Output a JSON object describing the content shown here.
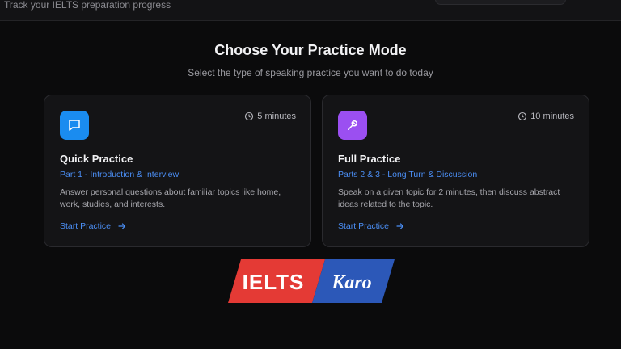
{
  "header": {
    "subtitle": "Track your IELTS preparation progress"
  },
  "hero": {
    "title": "Choose Your Practice Mode",
    "subtitle": "Select the type of speaking practice you want to do today"
  },
  "cards": [
    {
      "icon": "chat-bubble-icon",
      "accent": "#1a8cf0",
      "duration": "5 minutes",
      "title": "Quick Practice",
      "part": "Part 1 - Introduction & Interview",
      "description": "Answer personal questions about familiar topics like home, work, studies, and interests.",
      "cta": "Start Practice"
    },
    {
      "icon": "microphone-icon",
      "accent": "#9b4ff1",
      "duration": "10 minutes",
      "title": "Full Practice",
      "part": "Parts 2 & 3 - Long Turn & Discussion",
      "description": "Speak on a given topic for 2 minutes, then discuss abstract ideas related to the topic.",
      "cta": "Start Practice"
    }
  ],
  "logo": {
    "word_left": "IELTS",
    "word_right": "Karo",
    "color_left": "#e43a35",
    "color_right": "#2c58b8"
  },
  "colors": {
    "background": "#0b0b0c",
    "card": "#141416",
    "link": "#4b8ff6"
  }
}
